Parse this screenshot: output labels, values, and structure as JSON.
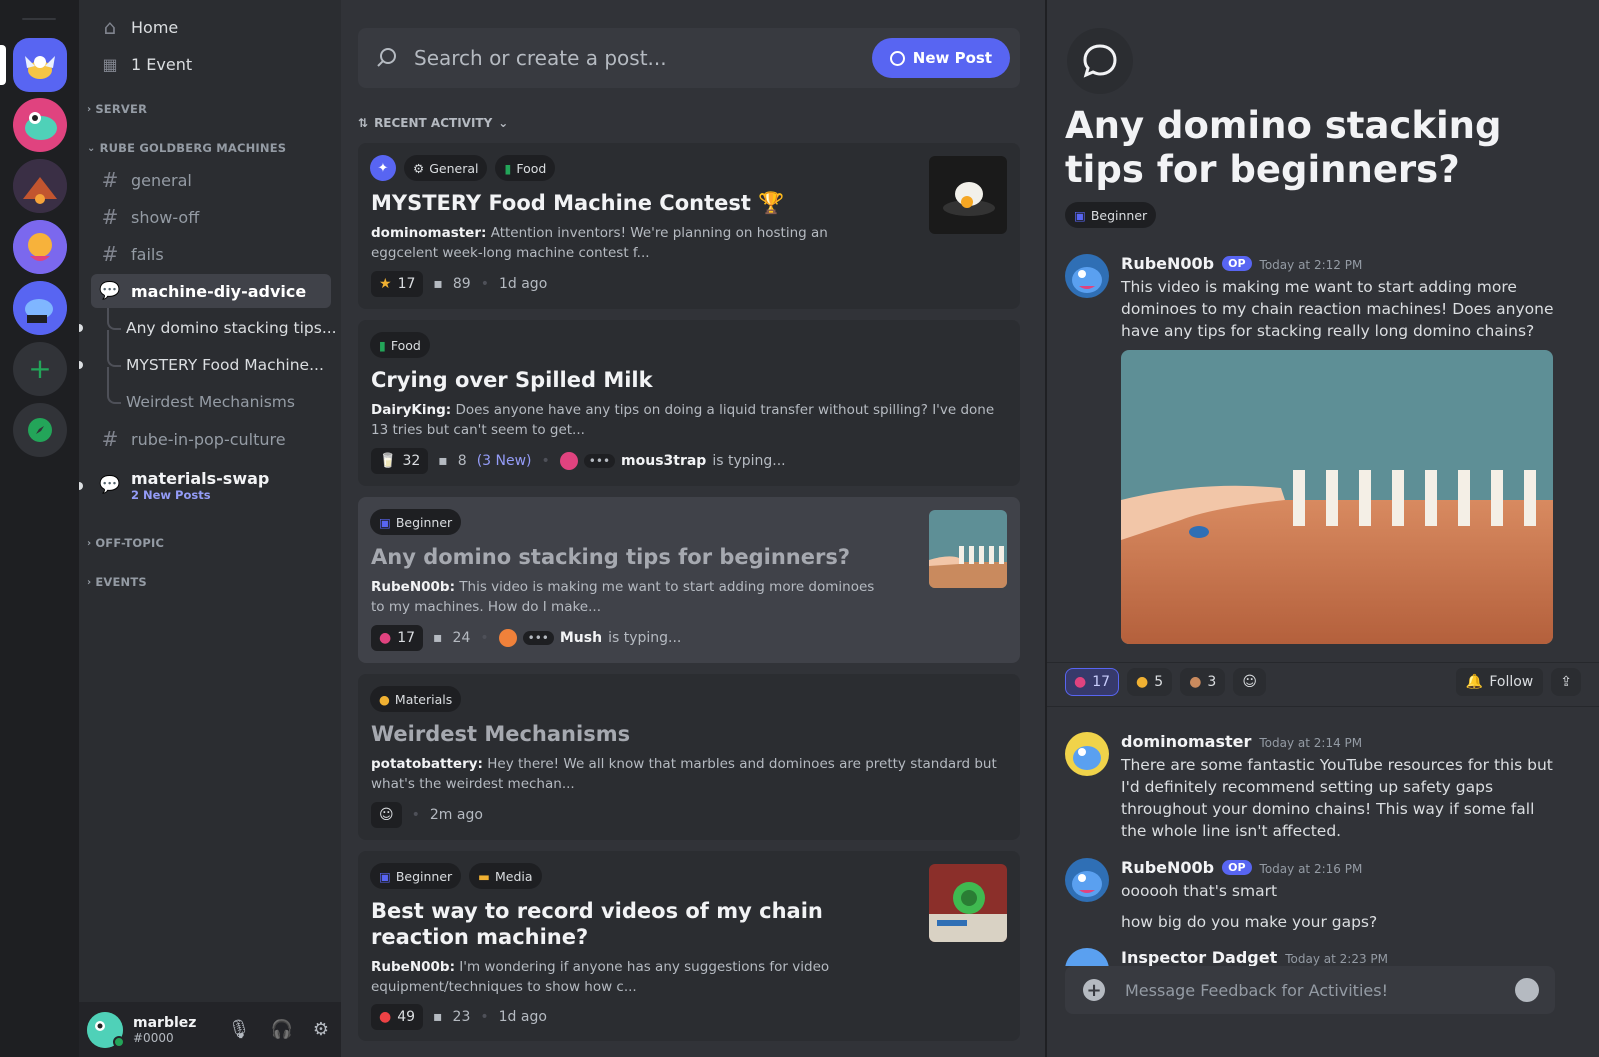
{
  "sidebar": {
    "home": "Home",
    "event": "1 Event",
    "categories": {
      "server": "SERVER",
      "rube": "RUBE GOLDBERG MACHINES",
      "offtopic": "OFF-TOPIC",
      "events": "EVENTS"
    },
    "channels": {
      "general": "general",
      "showoff": "show-off",
      "fails": "fails",
      "advice": "machine-diy-advice",
      "popculture": "rube-in-pop-culture",
      "swap": "materials-swap",
      "swap_new": "2 New Posts"
    },
    "threads": [
      "Any domino stacking tips...",
      "MYSTERY Food Machine...",
      "Weirdest Mechanisms"
    ]
  },
  "user": {
    "name": "marblez",
    "tag": "#0000"
  },
  "forum": {
    "search_placeholder": "Search or create a post...",
    "new_post": "New Post",
    "sort": "RECENT ACTIVITY",
    "posts": [
      {
        "tags": [
          "General",
          "Food"
        ],
        "title": "MYSTERY Food Machine Contest 🏆",
        "author": "dominomaster:",
        "snippet": "Attention inventors! We're planning on hosting an eggcelent week-long machine contest f...",
        "reaction": "17",
        "comments": "89",
        "time": "1d ago"
      },
      {
        "tags": [
          "Food"
        ],
        "title": "Crying over Spilled Milk",
        "author": "DairyKing:",
        "snippet": "Does anyone have any tips on doing a liquid transfer without spilling? I've done 13 tries but can't seem to get...",
        "reaction": "32",
        "comments": "8",
        "new": "(3 New)",
        "typer": "mous3trap",
        "typing": "is typing..."
      },
      {
        "tags": [
          "Beginner"
        ],
        "title": "Any domino stacking tips for beginners?",
        "author": "RubeN00b:",
        "snippet": "This video is making me want to start adding more dominoes to my machines. How do I make...",
        "reaction": "17",
        "comments": "24",
        "typer": "Mush",
        "typing": "is typing..."
      },
      {
        "tags": [
          "Materials"
        ],
        "title": "Weirdest Mechanisms",
        "author": "potatobattery:",
        "snippet": "Hey there! We all know that marbles and dominoes are pretty standard but what's the weirdest mechan...",
        "time": "2m ago"
      },
      {
        "tags": [
          "Beginner",
          "Media"
        ],
        "title": "Best way to record videos of my chain reaction machine?",
        "author": "RubeN00b:",
        "snippet": "I'm wondering if anyone has any suggestions for video equipment/techniques to show how c...",
        "reaction": "49",
        "comments": "23",
        "time": "1d ago"
      }
    ]
  },
  "panel": {
    "title": "Any domino stacking tips for beginners?",
    "tag": "Beginner",
    "op": {
      "name": "RubeN00b",
      "badge": "OP",
      "time": "Today at 2:12 PM",
      "text": "This video is making me want to start adding more dominoes to my chain reaction machines! Does anyone have any tips for stacking really long domino chains?"
    },
    "reactions": [
      "17",
      "5",
      "3"
    ],
    "follow": "Follow",
    "replies": [
      {
        "name": "dominomaster",
        "time": "Today at 2:14 PM",
        "text": "There are some fantastic YouTube resources for this but I'd definitely recommend setting up safety gaps throughout your domino chains! This way if some fall the whole line isn't affected."
      },
      {
        "name": "RubeN00b",
        "badge": "OP",
        "time": "Today at 2:16 PM",
        "text1": "oooooh that's smart",
        "text2": "how big do you make your gaps?"
      },
      {
        "name": "Inspector Dadget",
        "time": "Today at 2:23 PM"
      }
    ],
    "composer_placeholder": "Message Feedback for Activities!"
  },
  "colors": {
    "accent": "#5865f2",
    "bg_dark": "#1e1f22",
    "bg_sidebar": "#2b2d31",
    "bg_main": "#313338"
  }
}
